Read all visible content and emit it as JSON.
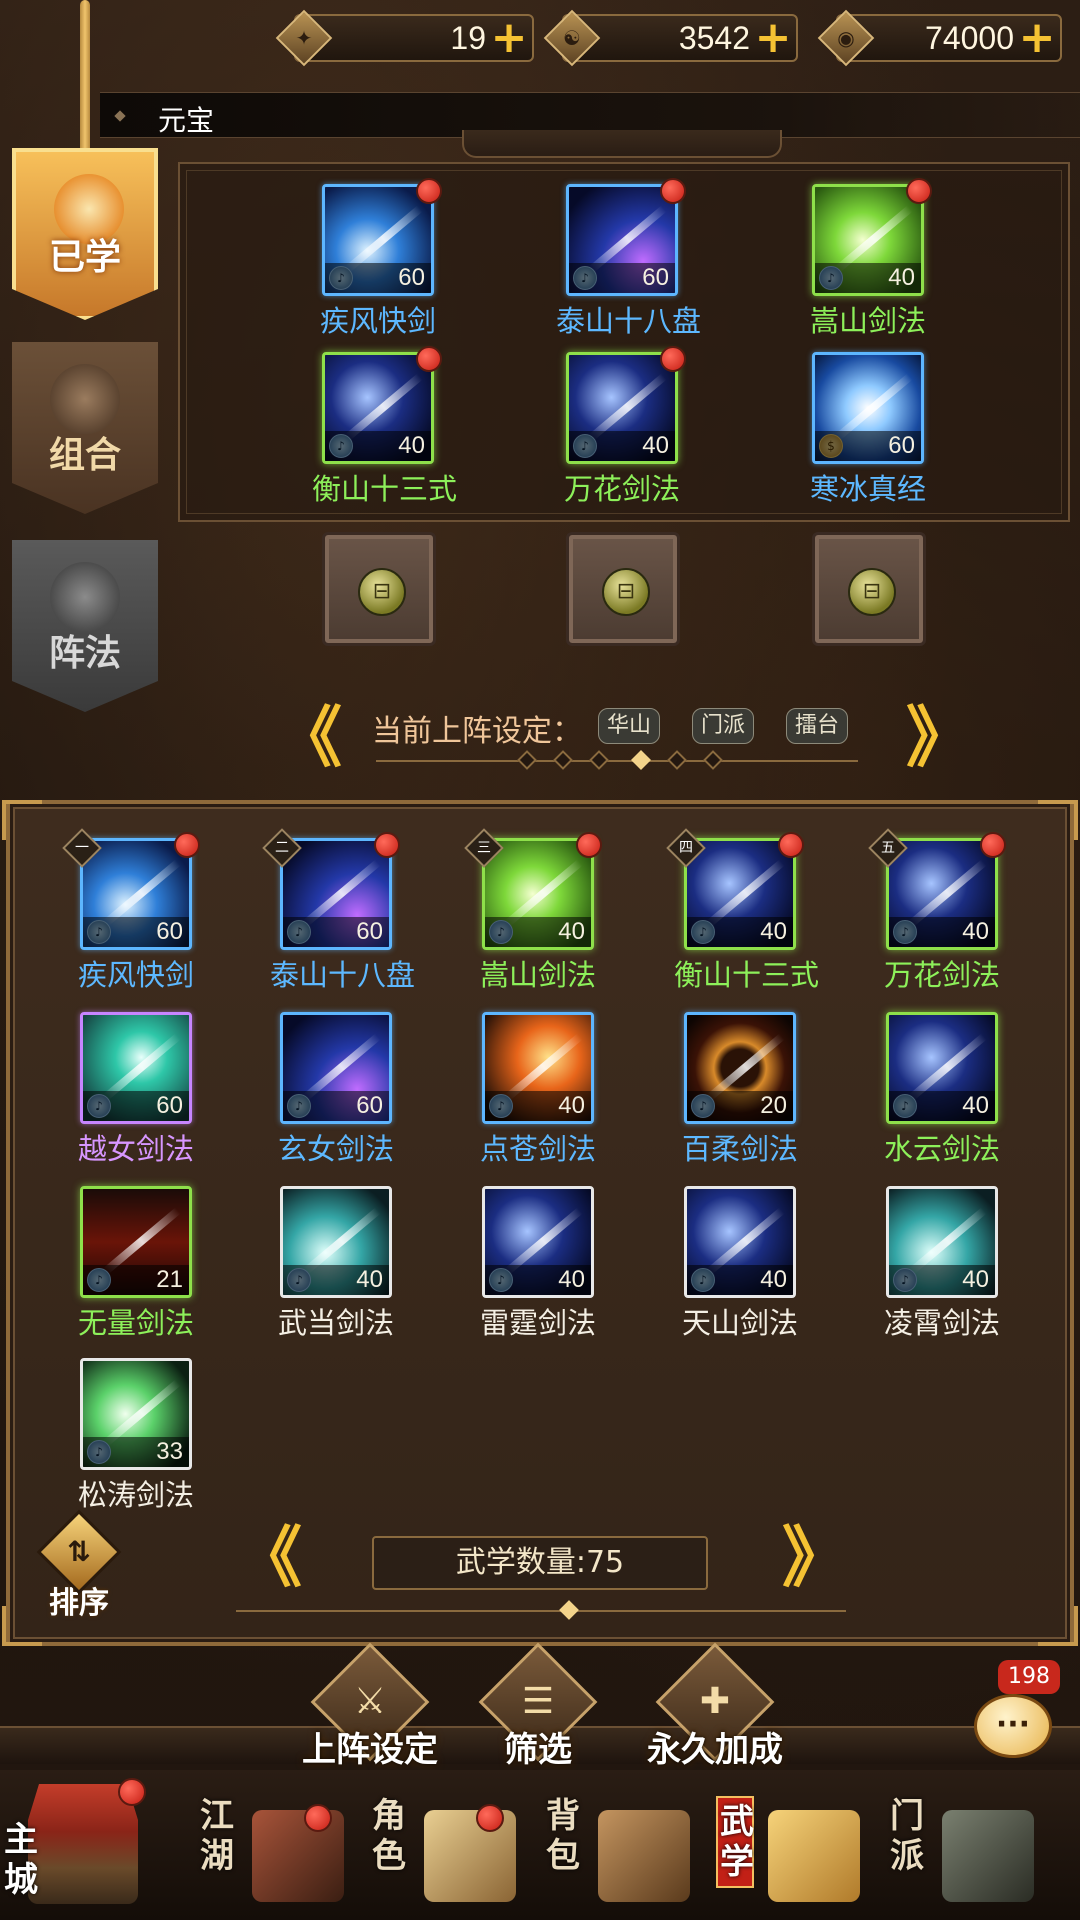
{
  "resources": [
    {
      "icon": "token-icon",
      "value": "19"
    },
    {
      "icon": "yinyang-coin-icon",
      "value": "3542"
    },
    {
      "icon": "silver-coin-icon",
      "value": "74000"
    }
  ],
  "tooltip": "元宝",
  "side_tabs": {
    "learned": "已学",
    "combo": "组合",
    "formation": "阵法"
  },
  "equipped": [
    {
      "name": "疾风快剑",
      "level": "60",
      "rarity": "blue",
      "art": "a-blue"
    },
    {
      "name": "泰山十八盘",
      "level": "60",
      "rarity": "blue",
      "art": "a-deep"
    },
    {
      "name": "嵩山剑法",
      "level": "40",
      "rarity": "green",
      "art": "a-green"
    },
    {
      "name": "衡山十三式",
      "level": "40",
      "rarity": "green",
      "art": "a-dark"
    },
    {
      "name": "万花剑法",
      "level": "40",
      "rarity": "green",
      "art": "a-dark"
    },
    {
      "name": "寒冰真经",
      "level": "60",
      "rarity": "blue",
      "art": "a-ice"
    }
  ],
  "formation": {
    "label": "当前上阵设定：",
    "chips": [
      "华山",
      "门派",
      "擂台"
    ]
  },
  "library": [
    {
      "name": "疾风快剑",
      "level": "60",
      "rarity": "blue",
      "order": "一",
      "art": "a-blue"
    },
    {
      "name": "泰山十八盘",
      "level": "60",
      "rarity": "blue",
      "order": "二",
      "art": "a-deep"
    },
    {
      "name": "嵩山剑法",
      "level": "40",
      "rarity": "green",
      "order": "三",
      "art": "a-green"
    },
    {
      "name": "衡山十三式",
      "level": "40",
      "rarity": "green",
      "order": "四",
      "art": "a-dark"
    },
    {
      "name": "万花剑法",
      "level": "40",
      "rarity": "green",
      "order": "五",
      "art": "a-dark"
    },
    {
      "name": "越女剑法",
      "level": "60",
      "rarity": "purple",
      "art": "a-purple"
    },
    {
      "name": "玄女剑法",
      "level": "60",
      "rarity": "blue",
      "art": "a-deep"
    },
    {
      "name": "点苍剑法",
      "level": "40",
      "rarity": "blue",
      "art": "a-fire"
    },
    {
      "name": "百柔剑法",
      "level": "20",
      "rarity": "blue",
      "art": "a-ring"
    },
    {
      "name": "水云剑法",
      "level": "40",
      "rarity": "green",
      "art": "a-dark"
    },
    {
      "name": "无量剑法",
      "level": "21",
      "rarity": "green",
      "art": "a-red"
    },
    {
      "name": "武当剑法",
      "level": "40",
      "rarity": "white",
      "art": "a-teal"
    },
    {
      "name": "雷霆剑法",
      "level": "40",
      "rarity": "white",
      "art": "a-dark"
    },
    {
      "name": "天山剑法",
      "level": "40",
      "rarity": "white",
      "art": "a-dark"
    },
    {
      "name": "凌霄剑法",
      "level": "40",
      "rarity": "white",
      "art": "a-teal"
    },
    {
      "name": "松涛剑法",
      "level": "33",
      "rarity": "white",
      "art": "a-lime"
    }
  ],
  "sort_label": "排序",
  "count_label": "武学数量:75",
  "actions": {
    "lineup": "上阵设定",
    "filter": "筛选",
    "bonus": "永久加成"
  },
  "chat_badge": "198",
  "nav": {
    "home": "主城",
    "jianghu": "江湖",
    "role": "角色",
    "bag": "背包",
    "martial": "武学",
    "sect": "门派"
  },
  "colors": {
    "accent_gold": "#f5c233",
    "badge_red": "#c41c12",
    "rarity_blue": "#5db8ff",
    "rarity_green": "#8df05a",
    "rarity_purple": "#d796ff"
  }
}
